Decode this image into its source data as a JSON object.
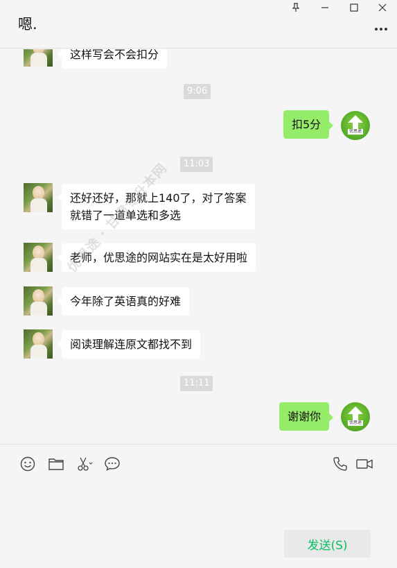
{
  "window": {
    "title": "嗯."
  },
  "chat": {
    "messages": [
      {
        "side": "left",
        "text": "这样写会不会扣分"
      },
      {
        "type": "time",
        "text": "9:06"
      },
      {
        "side": "right",
        "text": "扣5分"
      },
      {
        "type": "time",
        "text": "11:03"
      },
      {
        "side": "left",
        "lines": [
          "还好还好，那就上140了，对了答案",
          "就错了一道单选和多选"
        ]
      },
      {
        "side": "left",
        "text": "老师，优思途的网站实在是太好用啦"
      },
      {
        "side": "left",
        "text": "今年除了英语真的好难"
      },
      {
        "side": "left",
        "text": "阅读理解连原文都找不到"
      },
      {
        "type": "time",
        "text": "11:11"
      },
      {
        "side": "right",
        "text": "谢谢你"
      }
    ],
    "my_avatar_label": "优思途"
  },
  "watermark": "优思途 · 甘肃专升本网",
  "toolbar": {
    "icons": [
      "emoji-icon",
      "folder-icon",
      "scissors-icon",
      "chat-bubble-icon",
      "phone-icon",
      "video-icon"
    ]
  },
  "composer": {
    "send_label": "发送(S)"
  },
  "colors": {
    "my_bubble": "#95ec69",
    "their_bubble": "#ffffff",
    "send_text": "#07c160",
    "background": "#f5f5f5"
  }
}
